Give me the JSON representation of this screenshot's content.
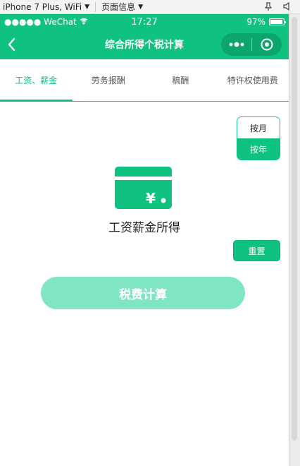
{
  "devtools": {
    "device": "iPhone 7 Plus, WiFi",
    "page_info": "页面信息"
  },
  "statusbar": {
    "carrier": "●●●●● WeChat",
    "time": "17:27",
    "battery_text": "97%",
    "battery_level": 0.97
  },
  "navbar": {
    "title": "综合所得个税计算"
  },
  "tabs": [
    {
      "label": "工资、薪金",
      "active": true
    },
    {
      "label": "劳务报酬",
      "active": false
    },
    {
      "label": "稿酬",
      "active": false
    },
    {
      "label": "特许权使用费",
      "active": false
    }
  ],
  "period": {
    "month_label": "按月",
    "year_label": "按年",
    "selected": "year"
  },
  "main": {
    "currency_symbol": "¥",
    "income_label": "工资薪金所得",
    "reset_label": "重置",
    "calc_label": "税费计算"
  },
  "colors": {
    "brand": "#0fc27f",
    "button_disabled": "#7fe5c4"
  },
  "icons": {
    "back": "chevron-left-icon",
    "more": "more-dots-icon",
    "close": "target-circle-icon",
    "card": "card-yen-icon",
    "wifi": "wifi-icon",
    "battery": "battery-icon"
  }
}
